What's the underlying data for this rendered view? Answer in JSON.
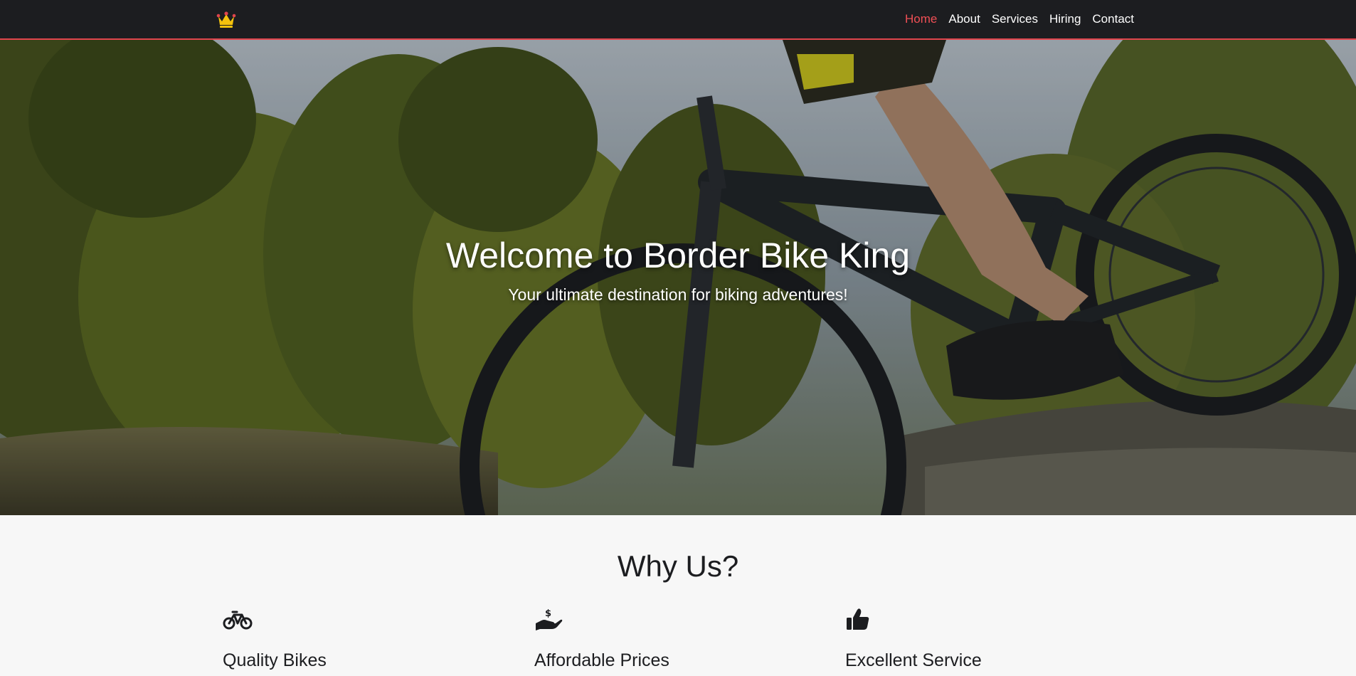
{
  "navbar": {
    "logo_icon": "crown-icon",
    "links": [
      {
        "label": "Home",
        "active": true
      },
      {
        "label": "About",
        "active": false
      },
      {
        "label": "Services",
        "active": false
      },
      {
        "label": "Hiring",
        "active": false
      },
      {
        "label": "Contact",
        "active": false
      }
    ],
    "accent_color": "#ef4f55",
    "background_color": "#1c1d20"
  },
  "hero": {
    "title": "Welcome to Border Bike King",
    "subtitle": "Your ultimate destination for biking adventures!",
    "background_image": "mountain biker riding over rock in forest"
  },
  "why_us": {
    "title": "Why Us?",
    "features": [
      {
        "icon": "bicycle-icon",
        "title": "Quality Bikes"
      },
      {
        "icon": "hand-dollar-icon",
        "title": "Affordable Prices"
      },
      {
        "icon": "thumbs-up-icon",
        "title": "Excellent Service"
      }
    ]
  }
}
